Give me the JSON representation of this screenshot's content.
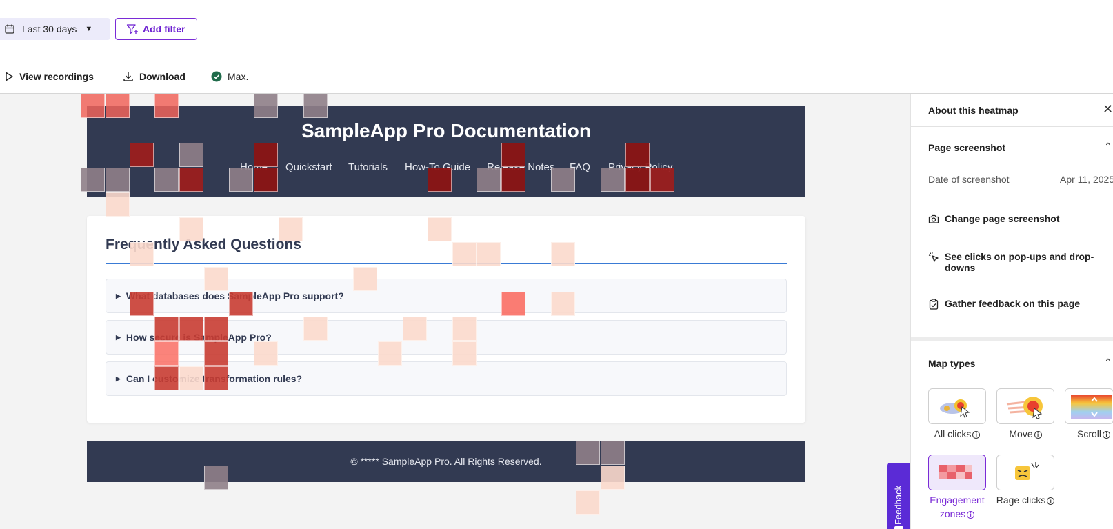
{
  "filters": {
    "date_range": "Last 30 days",
    "add_filter": "Add filter"
  },
  "actions": {
    "view_recordings": "View recordings",
    "download": "Download",
    "max": "Max."
  },
  "site": {
    "title": "SampleApp Pro Documentation",
    "nav": [
      "Home",
      "Quickstart",
      "Tutorials",
      "How-To Guide",
      "Release Notes",
      "FAQ",
      "Privacy Policy"
    ],
    "faq_title": "Frequently Asked Questions",
    "faq_items": [
      "What databases does SampleApp Pro support?",
      "How secure is SampleApp Pro?",
      "Can I customize transformation rules?"
    ],
    "footer": "© ***** SampleApp Pro. All Rights Reserved.",
    "feedback_tab": "Feedback"
  },
  "panel": {
    "title": "About this heatmap",
    "page_screenshot": {
      "heading": "Page screenshot",
      "date_label": "Date of screenshot",
      "date_value": "Apr 11, 2025",
      "change": "Change page screenshot",
      "popups": "See clicks on pop-ups and drop-downs",
      "feedback": "Gather feedback on this page"
    },
    "map_types": {
      "heading": "Map types",
      "items": [
        {
          "label": "All clicks",
          "active": false
        },
        {
          "label": "Move",
          "active": false
        },
        {
          "label": "Scroll",
          "active": false
        },
        {
          "label": "Engagement zones",
          "active": true
        },
        {
          "label": "Rage clicks",
          "active": false
        }
      ]
    }
  },
  "colors": {
    "accent": "#6c1fd1",
    "site_dark": "#323a52",
    "heat_hot": "#8b1414",
    "heat_warm": "#f06a5a",
    "heat_gray": "#8f8088",
    "heat_light": "#fbd9cc"
  }
}
